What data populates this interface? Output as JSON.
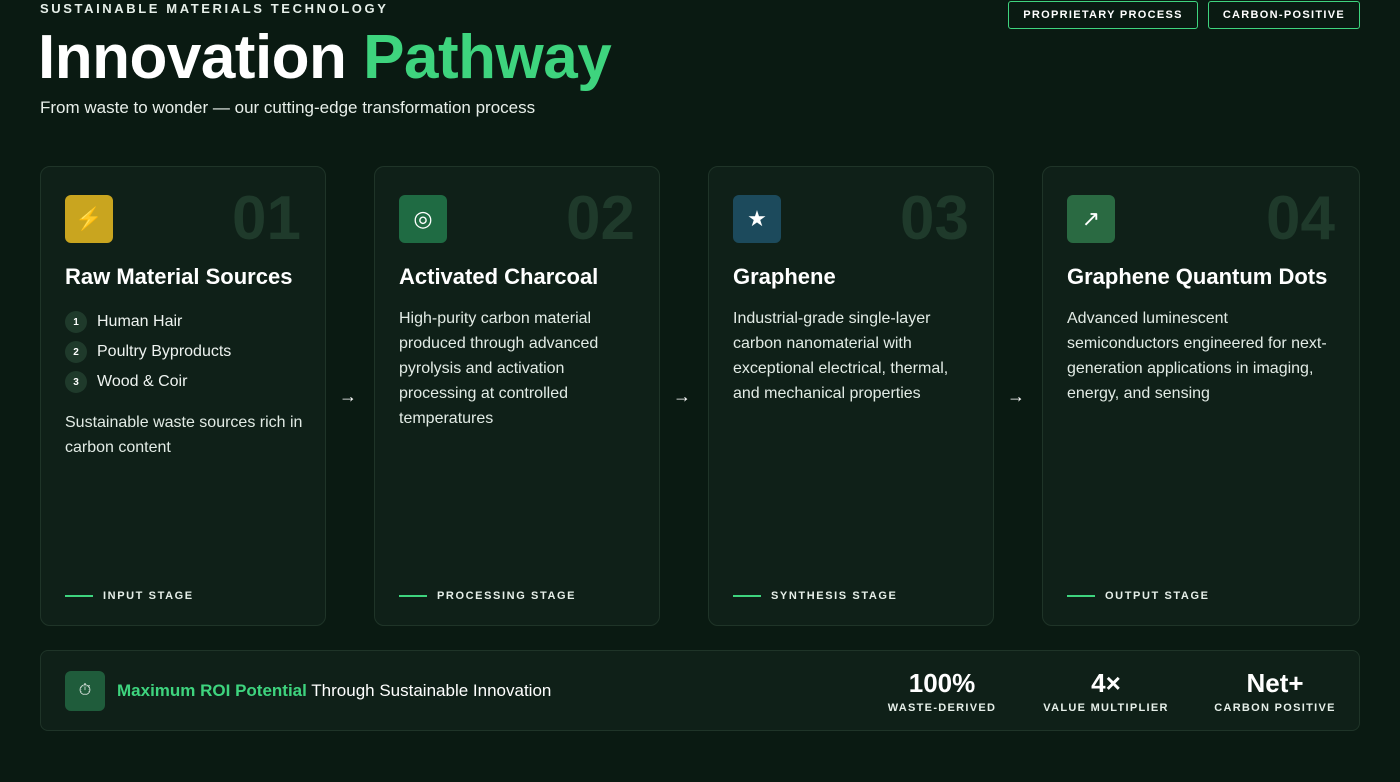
{
  "header": {
    "eyebrow": "SUSTAINABLE MATERIALS TECHNOLOGY",
    "title_main": "Innovation",
    "title_accent": "Pathway",
    "subtitle": "From waste to wonder — our cutting-edge transformation process",
    "badges": [
      "PROPRIETARY PROCESS",
      "CARBON-POSITIVE"
    ]
  },
  "colors": {
    "accent": "#3ed47e",
    "background": "#0a1a12",
    "card": "#0f2018",
    "icon_yellow": "#c9a51f",
    "icon_green": "#1f6b43",
    "icon_blue": "#1c4a5c",
    "icon_green2": "#2a6a42"
  },
  "stages": [
    {
      "number": "01",
      "icon": "lightning-icon",
      "glyph": "⚡",
      "title": "Raw Material Sources",
      "sources": [
        "Human Hair",
        "Poultry Byproducts",
        "Wood & Coir"
      ],
      "source_numbers": [
        "1",
        "2",
        "3"
      ],
      "description": "Sustainable waste sources rich in carbon content",
      "stage": "INPUT STAGE"
    },
    {
      "number": "02",
      "icon": "target-icon",
      "glyph": "◎",
      "title": "Activated Charcoal",
      "description": "High-purity carbon material produced through advanced pyrolysis and activation processing at controlled temperatures",
      "stage": "PROCESSING STAGE"
    },
    {
      "number": "03",
      "icon": "star-icon",
      "glyph": "★",
      "title": "Graphene",
      "description": "Industrial-grade single-layer carbon nanomaterial with exceptional electrical, thermal, and mechanical properties",
      "stage": "SYNTHESIS STAGE"
    },
    {
      "number": "04",
      "icon": "trend-up-arrow-icon",
      "glyph": "↗",
      "title": "Graphene Quantum Dots",
      "description": "Advanced luminescent semiconductors engineered for next-generation applications in imaging, energy, and sensing",
      "stage": "OUTPUT STAGE"
    }
  ],
  "arrow_glyph": "→",
  "footer": {
    "icon": "stopwatch-icon",
    "glyph": "⏱",
    "highlight": "Maximum ROI Potential",
    "text": " Through Sustainable Innovation",
    "stats": [
      {
        "value": "100%",
        "label": "WASTE-DERIVED"
      },
      {
        "value": "4×",
        "label": "VALUE MULTIPLIER"
      },
      {
        "value": "Net+",
        "label": "CARBON POSITIVE"
      }
    ]
  }
}
